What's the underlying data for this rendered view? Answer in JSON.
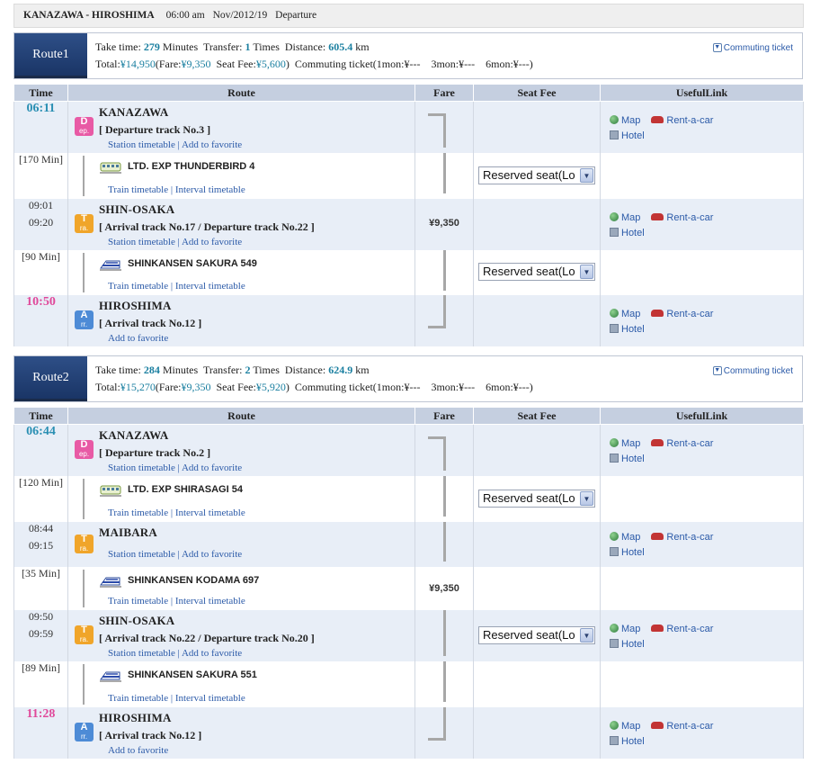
{
  "header": {
    "title": "KANAZAWA - HIROSHIMA",
    "time": "06:00 am",
    "date": "Nov/2012/19",
    "mode": "Departure"
  },
  "columns": [
    "Time",
    "Route",
    "Fare",
    "Seat Fee",
    "UsefulLink"
  ],
  "common": {
    "station_links": [
      "Station timetable",
      "Add to favorite"
    ],
    "train_links": [
      "Train timetable",
      "Interval timetable"
    ],
    "add_favorite": "Add to favorite",
    "map": "Map",
    "rent": "Rent-a-car",
    "hotel": "Hotel",
    "seat_select": "Reserved seat(Lo",
    "commuting_ticket_link": "Commuting ticket",
    "badges": {
      "dep": [
        "D",
        "ep."
      ],
      "tra": [
        "T",
        "ra."
      ],
      "arr": [
        "A",
        "rr."
      ]
    }
  },
  "routes": [
    {
      "label": "Route1",
      "take_time_label": "Take time:",
      "take_time": "279",
      "minutes": "Minutes",
      "transfer_label": "Transfer:",
      "transfer": "1",
      "times": "Times",
      "distance_label": "Distance:",
      "distance": "605.4",
      "km": "km",
      "total_label": "Total:",
      "total": "¥14,950",
      "fare_label": "(Fare:",
      "fare": "¥9,350",
      "seat_label": "Seat Fee:",
      "seat": "¥5,600",
      "commute": "Commuting ticket(1mon:¥---　3mon:¥---　6mon:¥---)",
      "rows": [
        {
          "kind": "station",
          "time1": "06:11",
          "badge": "dep",
          "name": "KANAZAWA",
          "track": "[ Departure track No.3 ]",
          "links": "station"
        },
        {
          "kind": "train",
          "duration": "[170 Min]",
          "name": "LTD. EXP THUNDERBIRD 4",
          "train_type": "ltd"
        },
        {
          "kind": "station",
          "time1": "09:01",
          "time2": "09:20",
          "badge": "tra",
          "name": "SHIN-OSAKA",
          "track": "[ Arrival track No.17 / Departure track No.22 ]",
          "links": "station",
          "fare": "¥9,350"
        },
        {
          "kind": "train",
          "duration": "[90 Min]",
          "name": "SHINKANSEN SAKURA 549",
          "train_type": "shink"
        },
        {
          "kind": "station",
          "time1": "10:50",
          "badge": "arr",
          "name": "HIROSHIMA",
          "track": "[ Arrival track No.12 ]",
          "links": "fav"
        }
      ]
    },
    {
      "label": "Route2",
      "take_time_label": "Take time:",
      "take_time": "284",
      "minutes": "Minutes",
      "transfer_label": "Transfer:",
      "transfer": "2",
      "times": "Times",
      "distance_label": "Distance:",
      "distance": "624.9",
      "km": "km",
      "total_label": "Total:",
      "total": "¥15,270",
      "fare_label": "(Fare:",
      "fare": "¥9,350",
      "seat_label": "Seat Fee:",
      "seat": "¥5,920",
      "commute": "Commuting ticket(1mon:¥---　3mon:¥---　6mon:¥---)",
      "rows": [
        {
          "kind": "station",
          "time1": "06:44",
          "badge": "dep",
          "name": "KANAZAWA",
          "track": "[ Departure track No.2 ]",
          "links": "station"
        },
        {
          "kind": "train",
          "duration": "[120 Min]",
          "name": "LTD. EXP SHIRASAGI 54",
          "train_type": "ltd"
        },
        {
          "kind": "station",
          "time1": "08:44",
          "time2": "09:15",
          "badge": "tra",
          "name": "MAIBARA",
          "track": "",
          "links": "station"
        },
        {
          "kind": "train",
          "duration": "[35 Min]",
          "name": "SHINKANSEN KODAMA 697",
          "train_type": "shink",
          "fare": "¥9,350"
        },
        {
          "kind": "station",
          "time1": "09:50",
          "time2": "09:59",
          "badge": "tra",
          "name": "SHIN-OSAKA",
          "track": "[ Arrival track No.22 / Departure track No.20 ]",
          "links": "station"
        },
        {
          "kind": "train",
          "duration": "[89 Min]",
          "name": "SHINKANSEN SAKURA 551",
          "train_type": "shink"
        },
        {
          "kind": "station",
          "time1": "11:28",
          "badge": "arr",
          "name": "HIROSHIMA",
          "track": "[ Arrival track No.12 ]",
          "links": "fav"
        }
      ]
    }
  ]
}
